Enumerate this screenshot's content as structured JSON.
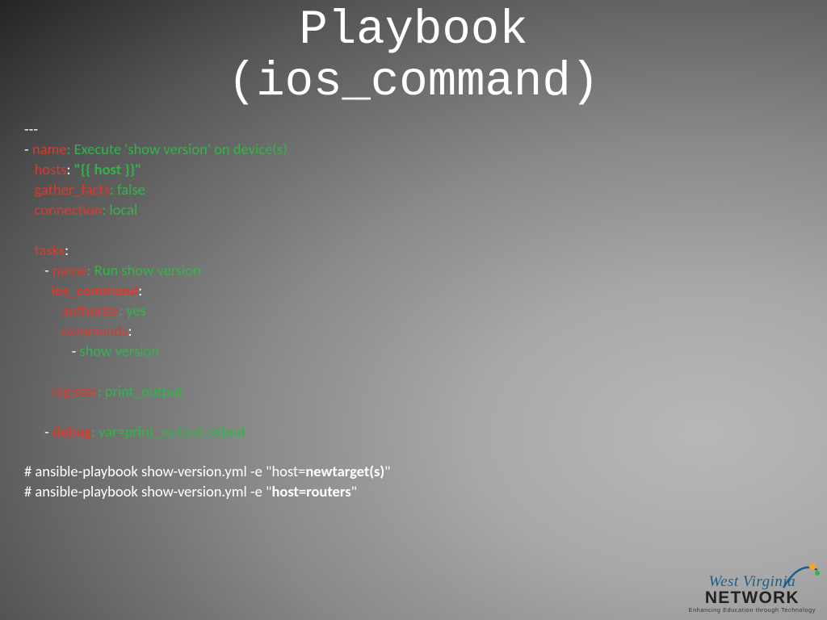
{
  "title_l1": "Playbook",
  "title_l2": "(ios_command)",
  "code": {
    "doc_start": "---",
    "dash": "- ",
    "name_k": "name",
    "name_v": ": Execute 'show version' on device(s)",
    "hosts_k": "hosts",
    "hosts_c": ": ",
    "hosts_v": "\"{{ host }}\"",
    "gf_k": "gather_facts",
    "gf_v": ": false",
    "conn_k": "connection",
    "conn_v": ": local",
    "tasks_k": "tasks",
    "tasks_c": ":",
    "tname_k": "name",
    "tname_v": ": Run show version",
    "ioscmd_k": "ios_command",
    "ioscmd_c": ":",
    "auth_k": "authorize",
    "auth_v": ": yes",
    "cmds_k": "commands",
    "cmds_c": ":",
    "cmd_dash": "- ",
    "cmd_v": "show version",
    "reg_k": "register",
    "reg_v": ": print_output",
    "dbg_dash": "- ",
    "dbg_k": "debug",
    "dbg_v": ": var=print_output.stdout",
    "c1_a": "# ansible-playbook show-version.yml -e \"host=",
    "c1_b": "newtarget(s)",
    "c1_c": "\"",
    "c2_a": "# ansible-playbook show-version.yml -e \"",
    "c2_b": "host=routers",
    "c2_c": "\""
  },
  "logo": {
    "line1": "West Virginia",
    "line2": "NETWORK",
    "tag": "Enhancing Education through Technology"
  }
}
